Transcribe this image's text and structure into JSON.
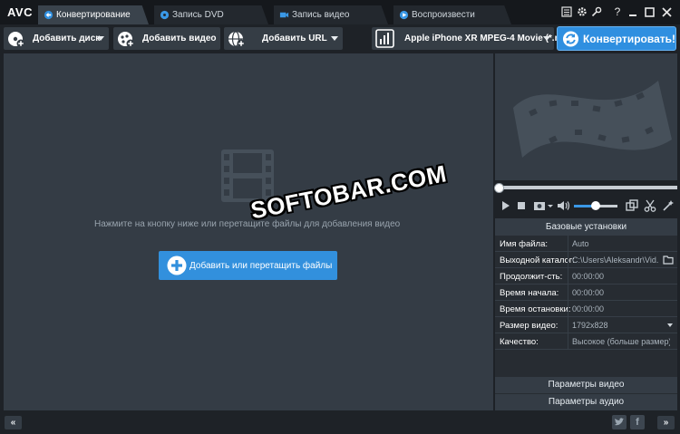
{
  "app": {
    "logo": "AVC"
  },
  "tabs": [
    {
      "label": "Конвертирование",
      "active": true
    },
    {
      "label": "Запись DVD",
      "active": false
    },
    {
      "label": "Запись видео",
      "active": false
    },
    {
      "label": "Воспроизвести",
      "active": false
    }
  ],
  "window_controls": [
    "list-icon",
    "gear-icon",
    "key-icon",
    "help-icon",
    "minimize-icon",
    "maximize-icon",
    "close-icon"
  ],
  "toolbar": {
    "add_disc": "Добавить диск",
    "add_video": "Добавить видео",
    "add_url": "Добавить URL",
    "profile": "Apple iPhone XR MPEG-4 Movie (*.m...",
    "convert": "Конвертировать!"
  },
  "drop_area": {
    "hint": "Нажмите на кнопку ниже или перетащите файлы для добавления видео",
    "add_files": "Добавить или перетащить файлы"
  },
  "watermark": "SOFTOBAR.COM",
  "player": {
    "progress": 0.0,
    "volume": 0.5
  },
  "settings": {
    "title": "Базовые установки",
    "rows": [
      {
        "label": "Имя файла:",
        "value": "Auto"
      },
      {
        "label": "Выходной каталог:",
        "value": "C:\\Users\\Aleksandr\\Vid..."
      },
      {
        "label": "Продолжит-сть:",
        "value": "00:00:00"
      },
      {
        "label": "Время начала:",
        "value": "00:00:00"
      },
      {
        "label": "Время остановки:",
        "value": "00:00:00"
      },
      {
        "label": "Размер видео:",
        "value": "1792x828"
      },
      {
        "label": "Качество:",
        "value": "Высокое (больше размер)"
      }
    ],
    "video_params": "Параметры видео",
    "audio_params": "Параметры аудио"
  },
  "bottom": {
    "collapse": "«",
    "expand": "»"
  },
  "colors": {
    "accent": "#2f8fe0",
    "panel": "#343c45",
    "background": "#1e2227"
  }
}
